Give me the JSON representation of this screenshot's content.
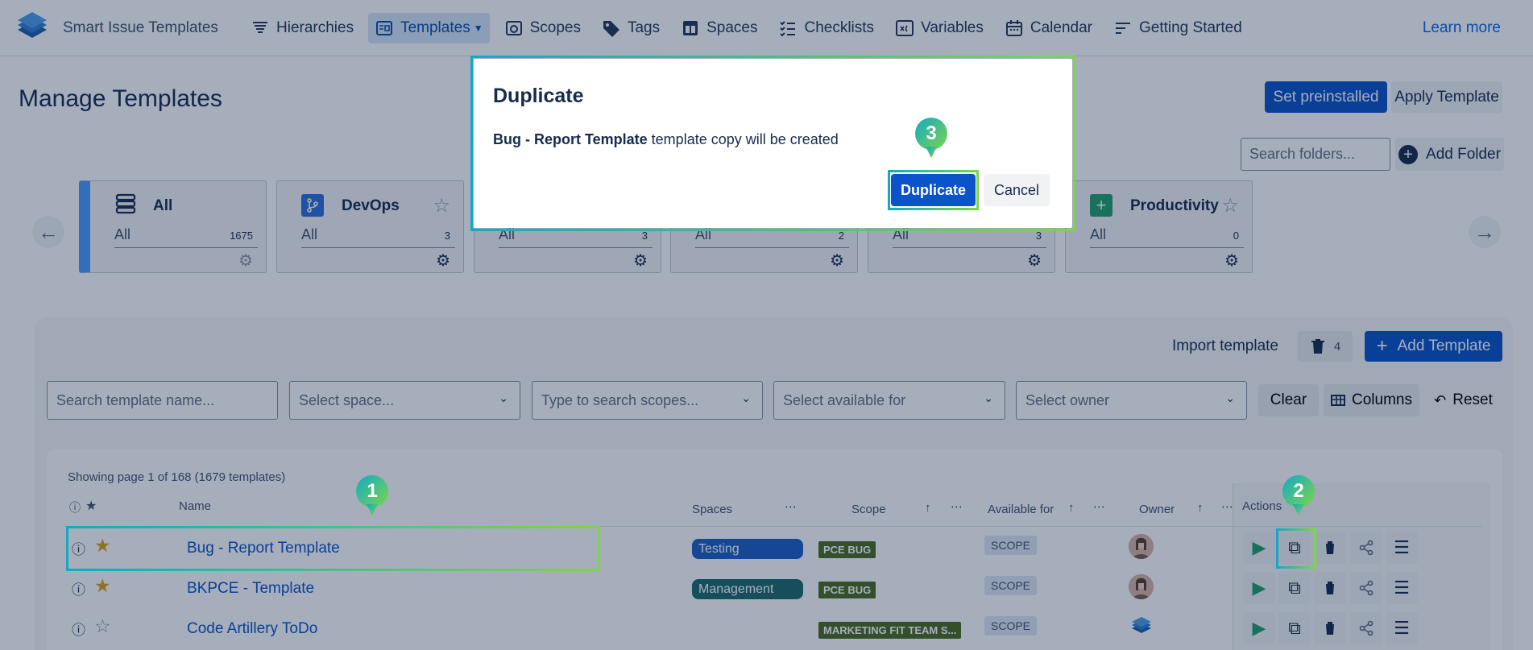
{
  "app": {
    "name": "Smart Issue Templates",
    "learn_more": "Learn more"
  },
  "nav": [
    {
      "label": "Hierarchies",
      "icon": "hierarchy-icon"
    },
    {
      "label": "Templates",
      "icon": "templates-icon",
      "active": true
    },
    {
      "label": "Scopes",
      "icon": "scopes-icon"
    },
    {
      "label": "Tags",
      "icon": "tag-icon"
    },
    {
      "label": "Spaces",
      "icon": "spaces-icon"
    },
    {
      "label": "Checklists",
      "icon": "checklist-icon"
    },
    {
      "label": "Variables",
      "icon": "variables-icon"
    },
    {
      "label": "Calendar",
      "icon": "calendar-icon"
    },
    {
      "label": "Getting Started",
      "icon": "getting-started-icon"
    }
  ],
  "header": {
    "title": "Manage Templates",
    "set_preinstalled": "Set preinstalled",
    "apply_template": "Apply Template",
    "folder_search_placeholder": "Search folders...",
    "add_folder": "Add Folder"
  },
  "folders": [
    {
      "name": "All",
      "sub": "All",
      "count": "1675",
      "icon": "stack-icon",
      "selected": true
    },
    {
      "name": "DevOps",
      "sub": "All",
      "count": "3",
      "icon": "branch-icon"
    },
    {
      "name": "",
      "sub": "All",
      "count": "3"
    },
    {
      "name": "",
      "sub": "All",
      "count": "2"
    },
    {
      "name": "",
      "sub": "All",
      "count": "3"
    },
    {
      "name": "Productivity",
      "sub": "All",
      "count": "0",
      "icon": "plus-square-icon"
    }
  ],
  "toolbar": {
    "import_template": "Import template",
    "trash_count": "4",
    "add_template": "Add Template"
  },
  "filters": {
    "name_placeholder": "Search template name...",
    "space_placeholder": "Select space...",
    "scope_placeholder": "Type to search scopes...",
    "available_placeholder": "Select available for",
    "owner_placeholder": "Select owner",
    "clear": "Clear",
    "columns": "Columns",
    "reset": "Reset"
  },
  "table": {
    "showing": "Showing page 1 of 168 (1679 templates)",
    "headers": {
      "name": "Name",
      "spaces": "Spaces",
      "scope": "Scope",
      "available_for": "Available for",
      "owner": "Owner",
      "actions": "Actions"
    },
    "rows": [
      {
        "name": "Bug - Report Template",
        "starred": true,
        "space": "Testing",
        "space_color": "#1d5fc2",
        "scope": "PCE BUG",
        "available": "SCOPE",
        "owner": "person"
      },
      {
        "name": "BKPCE - Template",
        "starred": true,
        "space": "Management",
        "space_color": "#206a6a",
        "scope": "PCE BUG",
        "available": "SCOPE",
        "owner": "person"
      },
      {
        "name": "Code Artillery ToDo",
        "starred": false,
        "space": "",
        "scope": "MARKETING FIT TEAM S...",
        "available": "SCOPE",
        "owner": "logo"
      }
    ]
  },
  "modal": {
    "title": "Duplicate",
    "template_name": "Bug - Report Template",
    "message_suffix": " template copy will be created",
    "confirm": "Duplicate",
    "cancel": "Cancel"
  },
  "markers": [
    "1",
    "2",
    "3"
  ],
  "colors": {
    "primary": "#0c52c9",
    "accent_gradient_start": "#15a8c4",
    "accent_gradient_end": "#7bd64a",
    "star": "#d9a21b"
  }
}
